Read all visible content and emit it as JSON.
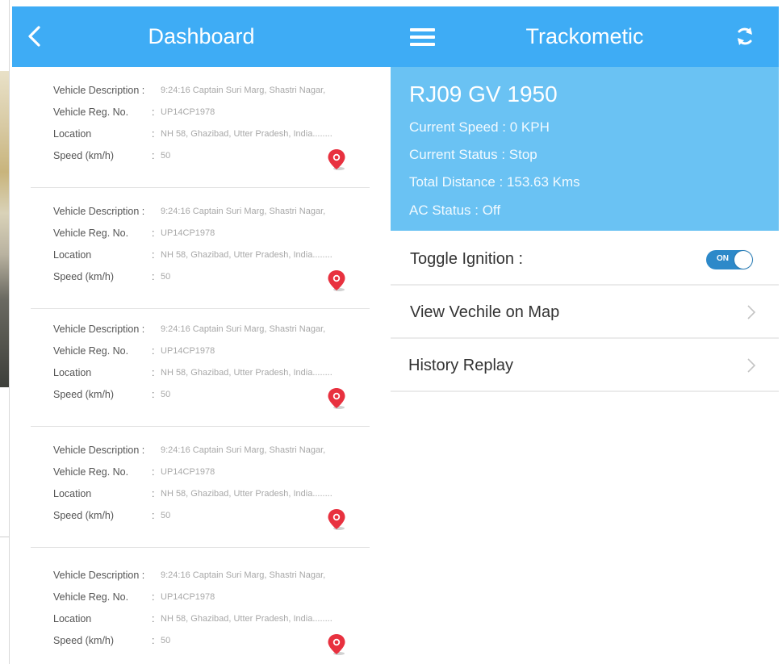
{
  "dashboard": {
    "title": "Dashboard",
    "cards": [
      {
        "desc_label": "Vehicle Description :",
        "desc": "9:24:16 Captain Suri Marg, Shastri Nagar,",
        "reg_label": "Vehicle Reg. No.",
        "reg": "UP14CP1978",
        "loc_label": "Location",
        "loc": "NH 58, Ghazibad, Utter Pradesh, India........",
        "speed_label": "Speed (km/h)",
        "speed": "50"
      },
      {
        "desc_label": "Vehicle Description :",
        "desc": "9:24:16 Captain Suri Marg, Shastri Nagar,",
        "reg_label": "Vehicle Reg. No.",
        "reg": "UP14CP1978",
        "loc_label": "Location",
        "loc": "NH 58, Ghazibad, Utter Pradesh, India........",
        "speed_label": "Speed (km/h)",
        "speed": "50"
      },
      {
        "desc_label": "Vehicle Description :",
        "desc": "9:24:16 Captain Suri Marg, Shastri Nagar,",
        "reg_label": "Vehicle Reg. No.",
        "reg": "UP14CP1978",
        "loc_label": "Location",
        "loc": "NH 58, Ghazibad, Utter Pradesh, India........",
        "speed_label": "Speed (km/h)",
        "speed": "50"
      },
      {
        "desc_label": "Vehicle Description :",
        "desc": "9:24:16 Captain Suri Marg, Shastri Nagar,",
        "reg_label": "Vehicle Reg. No.",
        "reg": "UP14CP1978",
        "loc_label": "Location",
        "loc": "NH 58, Ghazibad, Utter Pradesh, India........",
        "speed_label": "Speed (km/h)",
        "speed": "50"
      },
      {
        "desc_label": "Vehicle Description :",
        "desc": "9:24:16 Captain Suri Marg, Shastri Nagar,",
        "reg_label": "Vehicle Reg. No.",
        "reg": "UP14CP1978",
        "loc_label": "Location",
        "loc": "NH 58, Ghazibad, Utter Pradesh, India........",
        "speed_label": "Speed (km/h)",
        "speed": "50"
      }
    ],
    "colon": ":",
    "icons": {
      "back": "chevron-left-icon",
      "pin": "map-pin-icon"
    }
  },
  "tracker": {
    "title": "Trackometic",
    "reg_no": "RJ09 GV 1950",
    "current_speed": "Current Speed : 0 KPH",
    "current_status": "Current Status : Stop",
    "total_distance": "Total Distance : 153.63 Kms",
    "ac_status": "AC Status : Off",
    "toggle_label": "Toggle Ignition :",
    "toggle_state": "ON",
    "view_map": "View Vechile on Map",
    "history": "History Replay",
    "icons": {
      "menu": "hamburger-menu-icon",
      "refresh": "refresh-icon",
      "chevron": "chevron-right-icon"
    }
  },
  "colors": {
    "header": "#3eacf5",
    "info_panel": "#6ac2f3",
    "pin": "#e8313f",
    "toggle_on": "#2d89c9"
  }
}
